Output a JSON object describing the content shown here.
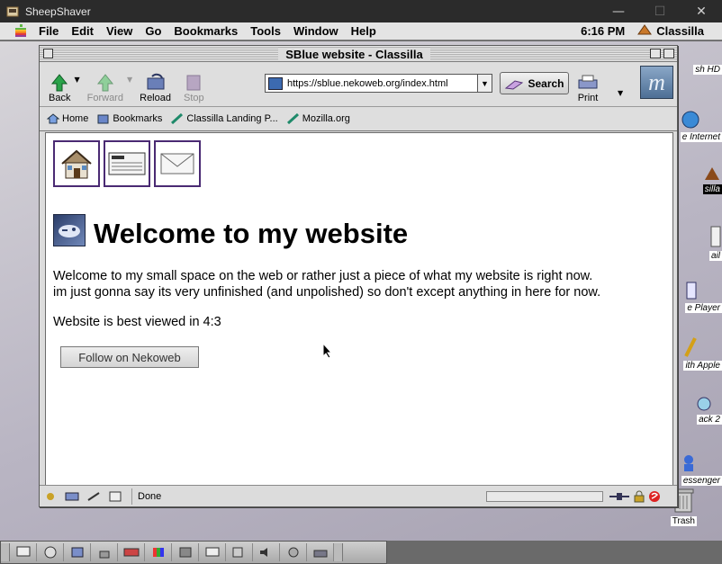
{
  "host": {
    "title": "SheepShaver",
    "controls": [
      "minimize-icon",
      "maximize-icon",
      "close-icon"
    ]
  },
  "menubar": {
    "items": [
      "File",
      "Edit",
      "View",
      "Go",
      "Bookmarks",
      "Tools",
      "Window",
      "Help"
    ],
    "clock": "6:16 PM",
    "app_name": "Classilla"
  },
  "window": {
    "title": "SBlue website - Classilla"
  },
  "toolbar": {
    "back": "Back",
    "forward": "Forward",
    "reload": "Reload",
    "stop": "Stop",
    "url": "https://sblue.nekoweb.org/index.html",
    "search": "Search",
    "print": "Print"
  },
  "personal_toolbar": {
    "items": [
      "Home",
      "Bookmarks",
      "Classilla Landing P...",
      "Mozilla.org"
    ]
  },
  "page": {
    "heading": "Welcome to my website",
    "paragraph1_line1": "Welcome to my small space on the web or rather just a piece of what my website is right now.",
    "paragraph1_line2": "im just gonna say its very unfinished (and unpolished) so don't except anything in here for now.",
    "paragraph2": "Website is best viewed in 4:3",
    "follow_button": "Follow on Nekoweb"
  },
  "status": {
    "text": "Done"
  },
  "desktop_icons": {
    "labels": [
      "sh HD",
      "e Internet",
      "silla",
      "ail",
      "e Player",
      "ith Apple",
      "ack 2",
      "essenger",
      "Trash"
    ]
  }
}
